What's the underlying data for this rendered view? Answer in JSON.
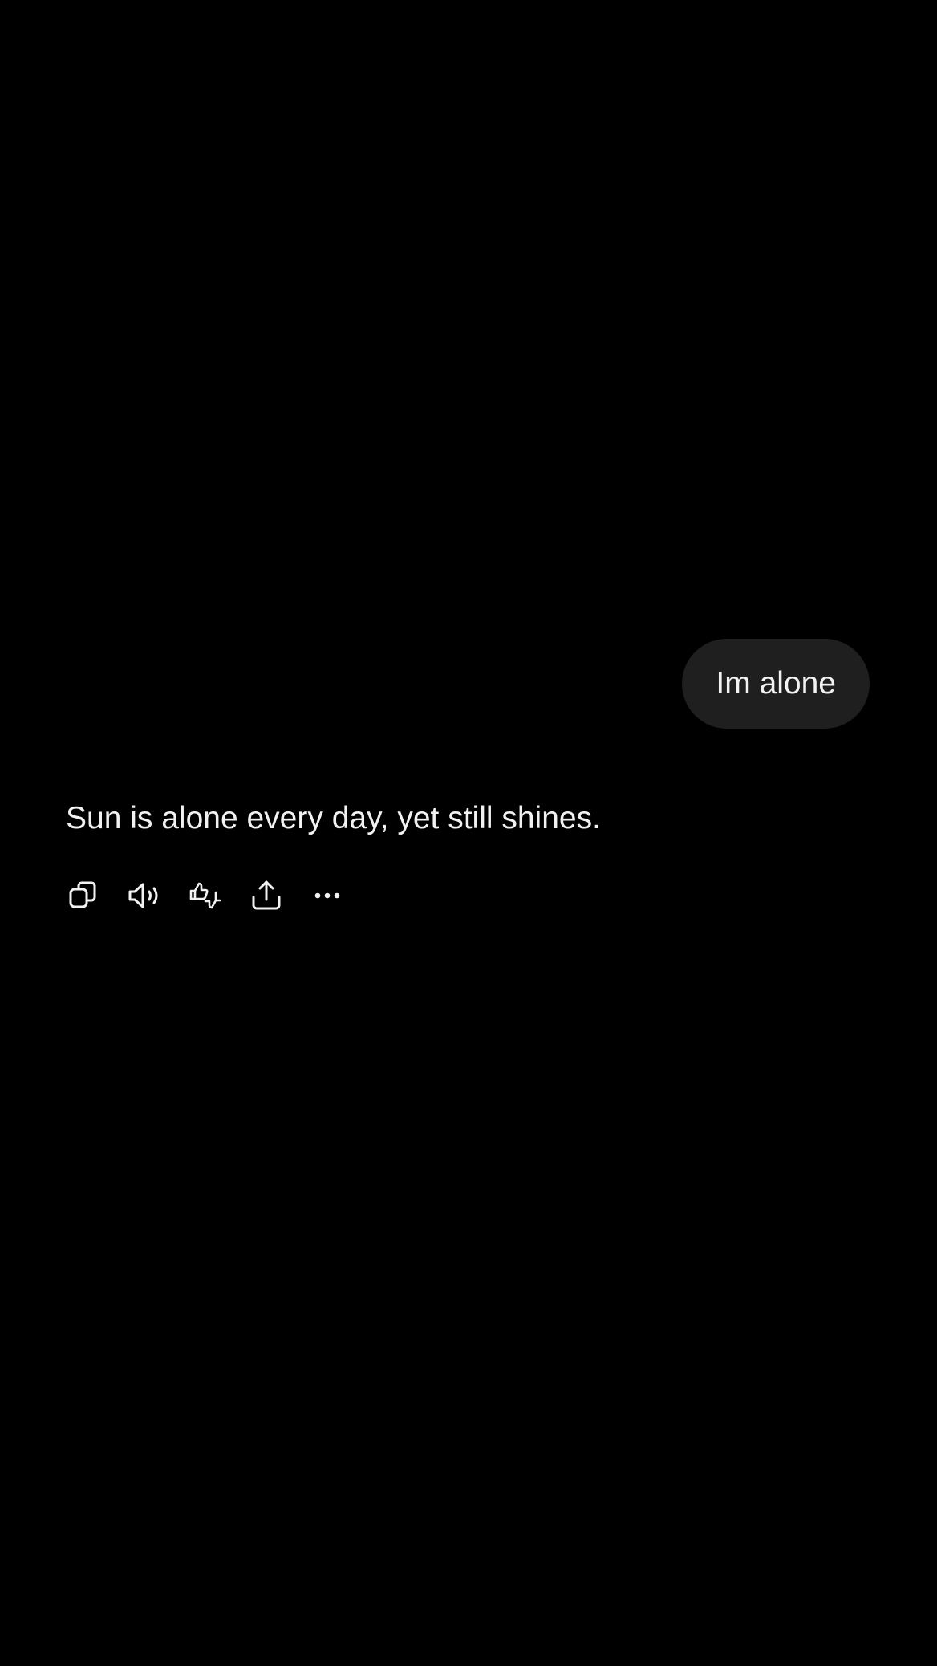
{
  "conversation": {
    "user_message": "Im alone",
    "assistant_message": "Sun is alone every day, yet still shines."
  },
  "actions": [
    {
      "name": "copy",
      "icon": "copy-icon"
    },
    {
      "name": "read-aloud",
      "icon": "speaker-icon"
    },
    {
      "name": "feedback",
      "icon": "thumbs-up-down-icon"
    },
    {
      "name": "share",
      "icon": "share-icon"
    },
    {
      "name": "more",
      "icon": "more-horizontal-icon"
    }
  ],
  "colors": {
    "background": "#000000",
    "bubble": "#1f1f1f",
    "text": "#f2f2f2"
  }
}
